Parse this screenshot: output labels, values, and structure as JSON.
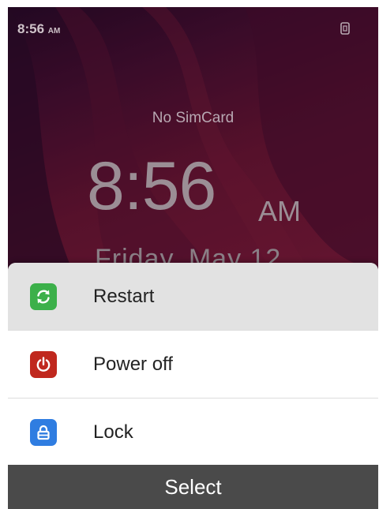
{
  "status_bar": {
    "time": "8:56",
    "ampm": "AM",
    "icon": "screen-rotate-icon"
  },
  "lockscreen": {
    "carrier": "No SimCard",
    "clock_time": "8:56",
    "clock_ampm": "AM",
    "date": "Friday, May 12"
  },
  "power_menu": {
    "items": [
      {
        "label": "Restart",
        "icon": "restart-icon",
        "color": "#3cb04a",
        "selected": true
      },
      {
        "label": "Power off",
        "icon": "power-icon",
        "color": "#c0281e",
        "selected": false
      },
      {
        "label": "Lock",
        "icon": "lock-icon",
        "color": "#2f7de1",
        "selected": false
      }
    ]
  },
  "softkey": {
    "label": "Select"
  }
}
